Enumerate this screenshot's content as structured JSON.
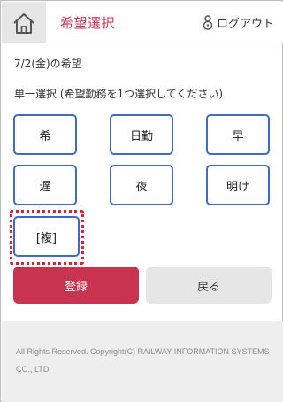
{
  "header": {
    "home_icon": "home-icon",
    "title": "希望選択",
    "logout_label": "ログアウト",
    "logout_icon": "lock-icon"
  },
  "main": {
    "date_label": "7/2(金)の希望",
    "instruction": "単一選択 (希望勤務を1つ選択してください)",
    "options": [
      "希",
      "日勤",
      "早",
      "遅",
      "夜",
      "明け",
      "[複]"
    ],
    "selected_option": "[複]"
  },
  "actions": {
    "register_label": "登録",
    "back_label": "戻る"
  },
  "footer": {
    "copyright": "All Rights Reserved. Copyright(C) RAILWAY INFORMATION SYSTEMS CO., LTD"
  },
  "colors": {
    "accent": "#c8334f",
    "option_border": "#4169c8",
    "selection_ring": "#e0202a"
  }
}
